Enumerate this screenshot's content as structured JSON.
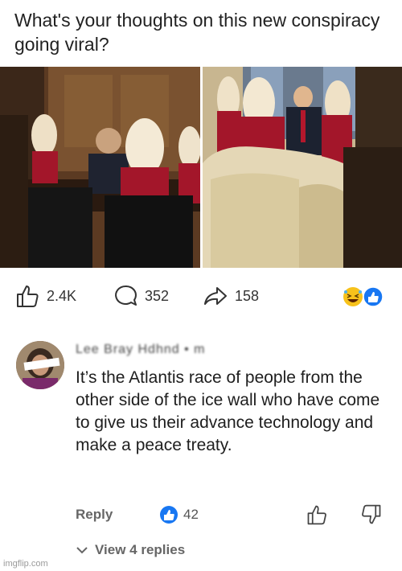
{
  "post": {
    "title": "What's your thoughts on this new conspiracy going viral?"
  },
  "actions": {
    "likes": "2.4K",
    "comments": "352",
    "shares": "158"
  },
  "comment": {
    "author": "Lee Bray Hdhnd • m",
    "text": "It’s the Atlantis race of people from the other side of the ice wall who have come to give us their advance technology and make a peace treaty.",
    "reply_label": "Reply",
    "like_count": "42",
    "view_replies_label": "View 4 replies"
  },
  "watermark": "imgflip.com",
  "colors": {
    "like_blue": "#1877f2",
    "uniform_red": "#a3162a",
    "hair_blonde": "#f2e6d0"
  }
}
